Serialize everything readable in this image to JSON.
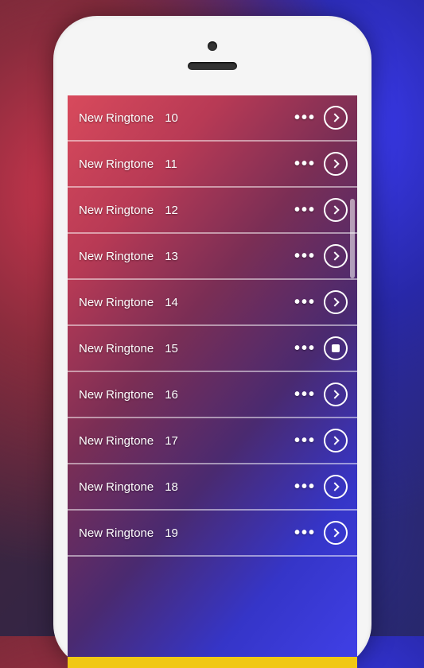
{
  "list": {
    "items": [
      {
        "label": "New Ringtone",
        "number": "10",
        "action": "play"
      },
      {
        "label": "New Ringtone",
        "number": "11",
        "action": "play"
      },
      {
        "label": "New Ringtone",
        "number": "12",
        "action": "play"
      },
      {
        "label": "New Ringtone",
        "number": "13",
        "action": "play"
      },
      {
        "label": "New Ringtone",
        "number": "14",
        "action": "play"
      },
      {
        "label": "New Ringtone",
        "number": "15",
        "action": "stop"
      },
      {
        "label": "New Ringtone",
        "number": "16",
        "action": "play"
      },
      {
        "label": "New Ringtone",
        "number": "17",
        "action": "play"
      },
      {
        "label": "New Ringtone",
        "number": "18",
        "action": "play"
      },
      {
        "label": "New Ringtone",
        "number": "19",
        "action": "play"
      }
    ]
  }
}
